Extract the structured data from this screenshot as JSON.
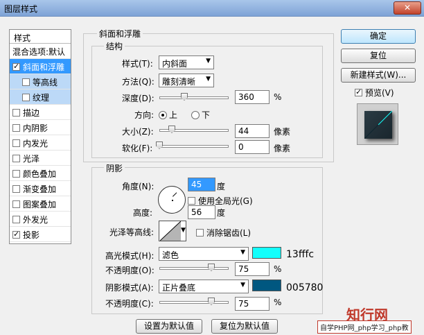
{
  "window": {
    "title": "图层样式",
    "close_label": "✕"
  },
  "styles": {
    "header": "样式",
    "items": [
      {
        "label": "混合选项:默认",
        "checkbox": false,
        "checked": false,
        "selected": false,
        "sub": false
      },
      {
        "label": "斜面和浮雕",
        "checkbox": true,
        "checked": true,
        "selected": true,
        "sub": false
      },
      {
        "label": "等高线",
        "checkbox": true,
        "checked": false,
        "selected": false,
        "sub": true
      },
      {
        "label": "纹理",
        "checkbox": true,
        "checked": false,
        "selected": false,
        "sub": true
      },
      {
        "label": "描边",
        "checkbox": true,
        "checked": false,
        "selected": false,
        "sub": false
      },
      {
        "label": "内阴影",
        "checkbox": true,
        "checked": false,
        "selected": false,
        "sub": false
      },
      {
        "label": "内发光",
        "checkbox": true,
        "checked": false,
        "selected": false,
        "sub": false
      },
      {
        "label": "光泽",
        "checkbox": true,
        "checked": false,
        "selected": false,
        "sub": false
      },
      {
        "label": "颜色叠加",
        "checkbox": true,
        "checked": false,
        "selected": false,
        "sub": false
      },
      {
        "label": "渐变叠加",
        "checkbox": true,
        "checked": false,
        "selected": false,
        "sub": false
      },
      {
        "label": "图案叠加",
        "checkbox": true,
        "checked": false,
        "selected": false,
        "sub": false
      },
      {
        "label": "外发光",
        "checkbox": true,
        "checked": false,
        "selected": false,
        "sub": false
      },
      {
        "label": "投影",
        "checkbox": true,
        "checked": true,
        "selected": false,
        "sub": false
      }
    ]
  },
  "bevel": {
    "section_title": "斜面和浮雕",
    "structure_title": "结构",
    "style_label": "样式(T):",
    "style_value": "内斜面",
    "technique_label": "方法(Q):",
    "technique_value": "雕刻清晰",
    "depth_label": "深度(D):",
    "depth_value": "360",
    "depth_unit": "%",
    "depth_level": 0.36,
    "direction_label": "方向:",
    "direction_up": "上",
    "direction_down": "下",
    "size_label": "大小(Z):",
    "size_value": "44",
    "size_unit": "像素",
    "size_level": 0.18,
    "soften_label": "软化(F):",
    "soften_value": "0",
    "soften_unit": "像素",
    "soften_level": 0.0
  },
  "shading": {
    "title": "阴影",
    "angle_label": "角度(N):",
    "angle_value": "45",
    "angle_unit": "度",
    "global_light_label": "使用全局光(G)",
    "altitude_label": "高度:",
    "altitude_value": "56",
    "altitude_unit": "度",
    "gloss_label": "光泽等高线:",
    "antialias_label": "消除锯齿(L)",
    "highlight_mode_label": "高光模式(H):",
    "highlight_mode_value": "滤色",
    "highlight_color": "#13fffc",
    "highlight_color_text": "13fffc",
    "highlight_opacity_label": "不透明度(O):",
    "highlight_opacity_value": "75",
    "highlight_opacity_unit": "%",
    "highlight_opacity_level": 0.75,
    "shadow_mode_label": "阴影模式(A):",
    "shadow_mode_value": "正片叠底",
    "shadow_color": "#005780",
    "shadow_color_text": "005780",
    "shadow_opacity_label": "不透明度(C):",
    "shadow_opacity_value": "75",
    "shadow_opacity_unit": "%",
    "shadow_opacity_level": 0.75
  },
  "bottom_buttons": {
    "make_default": "设置为默认值",
    "reset_default": "复位为默认值"
  },
  "actions": {
    "ok": "确定",
    "reset": "复位",
    "new_style": "新建样式(W)...",
    "preview_label": "预览(V)"
  },
  "watermark": {
    "text": "知行网",
    "site": "自学PHP网_php学习_php教"
  }
}
